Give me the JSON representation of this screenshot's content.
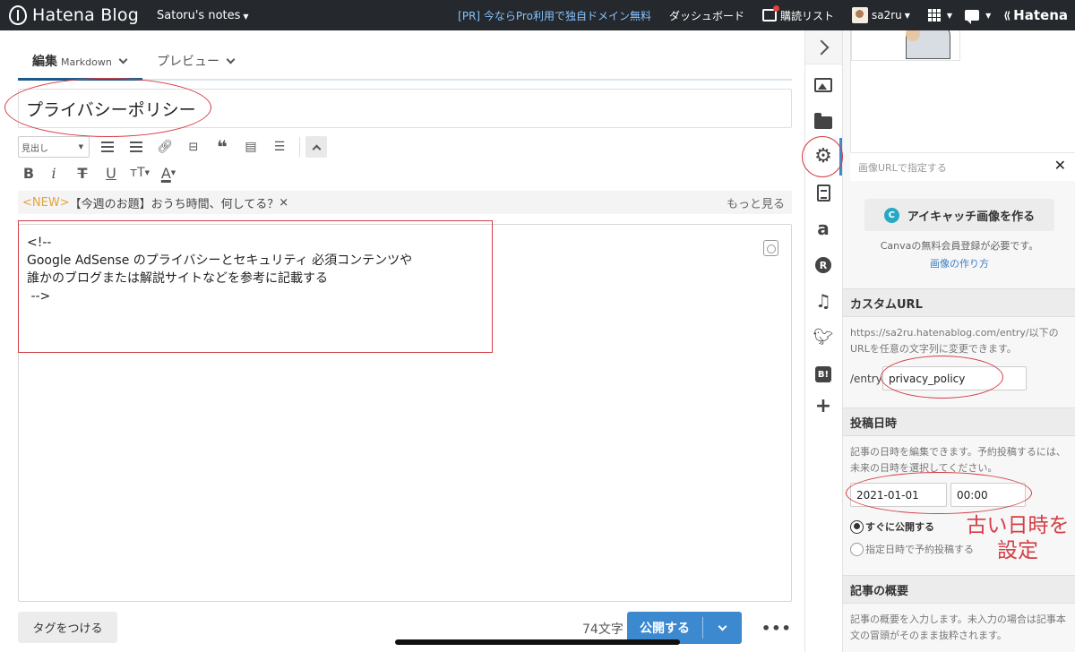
{
  "topbar": {
    "logo_text": "Hatena Blog",
    "blog_name": "Satoru's notes",
    "pr_link": "[PR] 今ならPro利用で独自ドメイン無料",
    "dashboard": "ダッシュボード",
    "reading_list": "購読リスト",
    "username": "sa2ru",
    "hatena": "Hatena"
  },
  "editor": {
    "tabs": [
      {
        "label": "編集",
        "sub": "Markdown"
      },
      {
        "label": "プレビュー"
      }
    ],
    "title": "プライバシーポリシー",
    "heading_select": "見出し",
    "notice": {
      "new_tag": "<NEW>",
      "text": "【今週のお題】おうち時間、何してる？",
      "close": "×",
      "more": "もっと見る"
    },
    "body_text": "<!--\nGoogle AdSense のプライバシーとセキュリティ 必須コンテンツや\n誰かのブログまたは解説サイトなどを参考に記載する\n -->",
    "tag_button": "タグをつける",
    "char_count": "74文字",
    "publish_button": "公開する",
    "more_menu": "•••"
  },
  "panel": {
    "image_url_placeholder": "画像URLで指定する",
    "close": "✕",
    "eyecatch_button": "アイキャッチ画像を作る",
    "canva_letter": "C",
    "canva_note": "Canvaの無料会員登録が必要です。",
    "canva_link": "画像の作り方",
    "custom_url": {
      "heading": "カスタムURL",
      "desc": "https://sa2ru.hatenablog.com/entry/以下のURLを任意の文字列に変更できます。",
      "prefix": "/entry/",
      "value": "privacy_policy"
    },
    "post_date": {
      "heading": "投稿日時",
      "desc": "記事の日時を編集できます。予約投稿するには、未来の日時を選択してください。",
      "date": "2021-01-01",
      "time": "00:00",
      "option_now": "すぐに公開する",
      "option_scheduled": "指定日時で予約投稿する"
    },
    "summary": {
      "heading": "記事の概要",
      "desc": "記事の概要を入力します。未入力の場合は記事本文の冒頭がそのまま抜粋されます。"
    }
  },
  "annotation": {
    "text": "古い日時を\n設定"
  },
  "colors": {
    "topbar": "#25282c",
    "accent": "#3c89d0",
    "annotation": "#d33f45"
  }
}
